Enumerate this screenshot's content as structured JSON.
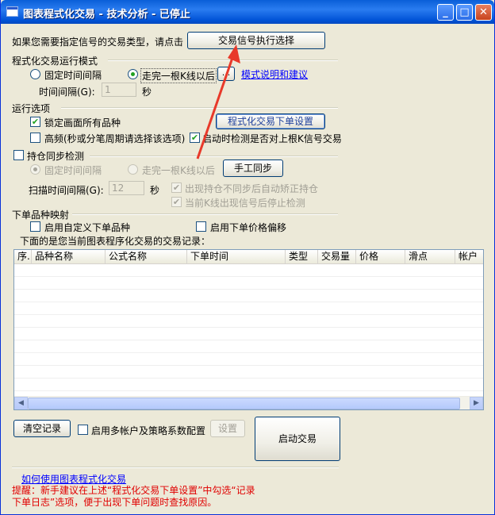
{
  "window": {
    "title": "图表程式化交易 - 技术分析 - 已停止",
    "buttons": {
      "minimize": "_",
      "maximize": "□",
      "close": "✕"
    }
  },
  "signal": {
    "prompt": "如果您需要指定信号的交易类型，请点击",
    "button": "交易信号执行选择"
  },
  "mode": {
    "title": "程式化交易运行模式",
    "fixed_interval": "固定时间间隔",
    "after_bar": "走完一根K线以后",
    "small_button": "...",
    "help_link": "模式说明和建议",
    "interval_label": "时间间隔(G):",
    "interval_value": "1",
    "unit": "秒",
    "selected": "after_bar"
  },
  "options": {
    "title": "运行选项",
    "lock_all": "锁定画面所有品种",
    "order_settings_button": "程式化交易下单设置",
    "high_freq": "高频(秒或分笔周期请选择该选项)",
    "check_on_start": "启动时检测是否对上根K信号交易"
  },
  "position_sync": {
    "label": "持仓同步检测",
    "fixed_interval": "固定时间间隔",
    "after_bar": "走完一根K线以后",
    "manual_button": "手工同步",
    "scan_label": "扫描时间间隔(G):",
    "scan_value": "12",
    "unit": "秒",
    "auto_correct": "出现持仓不同步后自动矫正持仓",
    "stop_on_signal": "当前K线出现信号后停止检测"
  },
  "mapping": {
    "title": "下单品种映射",
    "custom_symbol": "启用自定义下单品种",
    "price_offset": "启用下单价格偏移",
    "records_caption": "下面的是您当前图表程序化交易的交易记录："
  },
  "table": {
    "columns": [
      "序.",
      "品种名称",
      "公式名称",
      "下单时间",
      "类型",
      "交易量",
      "价格",
      "滑点",
      "帐户"
    ],
    "rows": []
  },
  "bottom": {
    "clear_button": "清空记录",
    "multi_account": "启用多帐户及策略系数配置",
    "settings_button": "设置",
    "start_button": "启动交易",
    "howto_link": "如何使用图表程式化交易",
    "warning_line1": "提醒：新手建议在上述“程式化交易下单设置”中勾选“记录",
    "warning_line2": "下单日志”选项，便于出现下单问题时查找原因。"
  },
  "colors": {
    "accent": "#0a5fd8",
    "warning": "#e00000",
    "link": "#0000ff",
    "arrow": "#e8392a"
  },
  "icons": {
    "check": "✔",
    "scroll_left": "◀",
    "scroll_right": "▶"
  }
}
